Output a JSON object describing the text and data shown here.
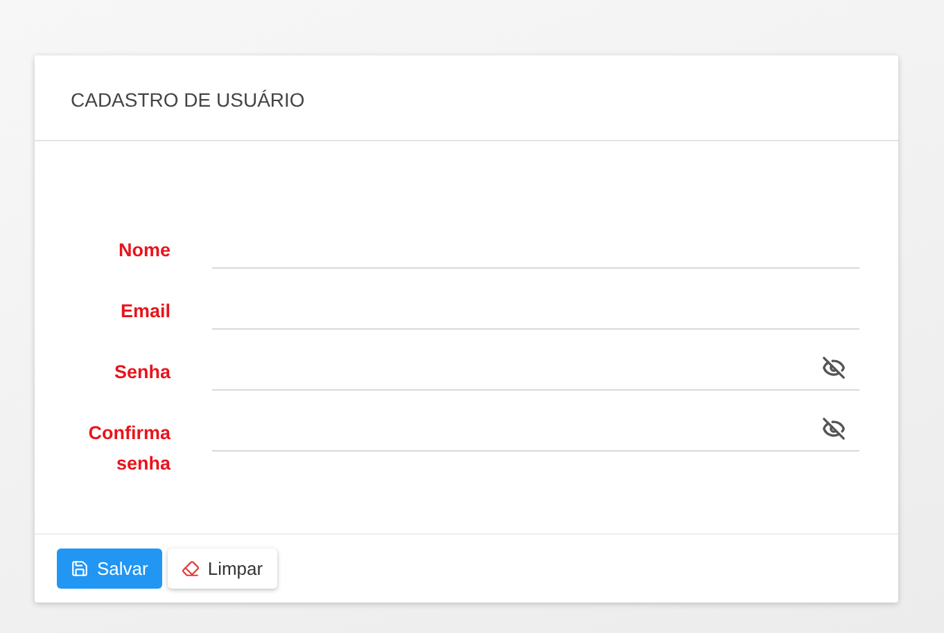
{
  "card": {
    "title": "CADASTRO DE USUÁRIO"
  },
  "fields": [
    {
      "label": "Nome",
      "kind": "text"
    },
    {
      "label": "Email",
      "kind": "text"
    },
    {
      "label": "Senha",
      "kind": "password"
    },
    {
      "label": "Confirma senha",
      "kind": "password"
    }
  ],
  "buttons": [
    {
      "label": "Salvar",
      "kind": "primary"
    },
    {
      "label": "Limpar",
      "kind": "secondary"
    }
  ]
}
